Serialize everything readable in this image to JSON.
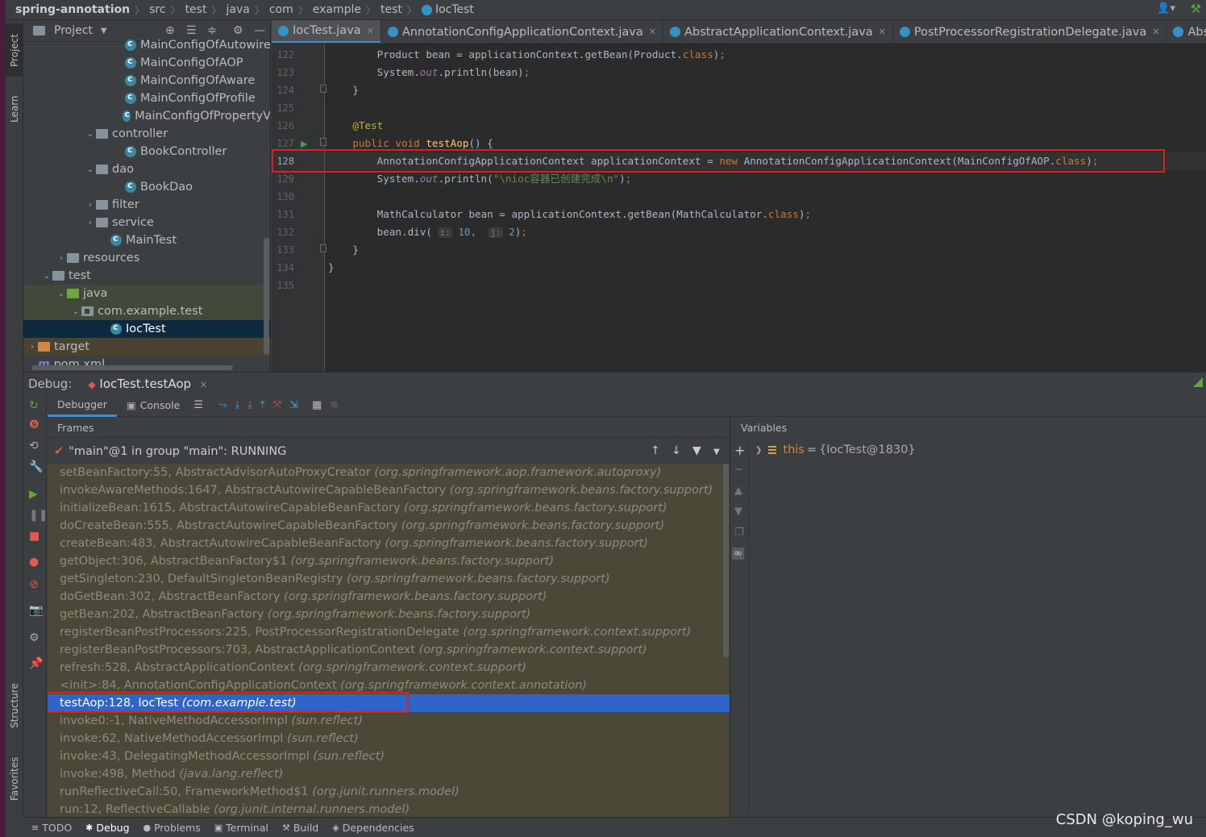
{
  "breadcrumb": [
    "spring-annotation",
    "src",
    "test",
    "java",
    "com",
    "example",
    "test",
    "IocTest"
  ],
  "left_stripe": {
    "project": "Project",
    "learn": "Learn",
    "structure": "Structure",
    "favorites": "Favorites"
  },
  "project_panel": {
    "title": "Project",
    "tree": [
      {
        "label": "MainConfigOfAutowire",
        "type": "class",
        "indent": 7
      },
      {
        "label": "MainConfigOfAOP",
        "type": "class",
        "indent": 7
      },
      {
        "label": "MainConfigOfAware",
        "type": "class",
        "indent": 7
      },
      {
        "label": "MainConfigOfProfile",
        "type": "class",
        "indent": 7
      },
      {
        "label": "MainConfigOfPropertyV",
        "type": "class",
        "indent": 7
      },
      {
        "label": "controller",
        "type": "folder",
        "indent": 5,
        "arrow": "down"
      },
      {
        "label": "BookController",
        "type": "class",
        "indent": 7
      },
      {
        "label": "dao",
        "type": "folder",
        "indent": 5,
        "arrow": "down"
      },
      {
        "label": "BookDao",
        "type": "class",
        "indent": 7
      },
      {
        "label": "filter",
        "type": "folder",
        "indent": 5,
        "arrow": "right"
      },
      {
        "label": "service",
        "type": "folder",
        "indent": 5,
        "arrow": "right"
      },
      {
        "label": "MainTest",
        "type": "class",
        "indent": 6
      },
      {
        "label": "resources",
        "type": "folder-res",
        "indent": 3,
        "arrow": "right"
      },
      {
        "label": "test",
        "type": "folder",
        "indent": 2,
        "arrow": "down"
      },
      {
        "label": "java",
        "type": "folder-green",
        "indent": 3,
        "arrow": "down",
        "style": "hl"
      },
      {
        "label": "com.example.test",
        "type": "folder-pkg",
        "indent": 4,
        "arrow": "down",
        "style": "hl"
      },
      {
        "label": "IocTest",
        "type": "class",
        "indent": 6,
        "style": "sel"
      },
      {
        "label": "target",
        "type": "folder-orange",
        "indent": 1,
        "arrow": "right",
        "style": "olive"
      },
      {
        "label": "pom.xml",
        "type": "maven",
        "indent": 1
      }
    ]
  },
  "editor_tabs": [
    {
      "label": "IocTest.java",
      "active": true
    },
    {
      "label": "AnnotationConfigApplicationContext.java",
      "active": false
    },
    {
      "label": "AbstractApplicationContext.java",
      "active": false
    },
    {
      "label": "PostProcessorRegistrationDelegate.java",
      "active": false
    },
    {
      "label": "Abstract",
      "active": false
    }
  ],
  "editor": {
    "lines": [
      {
        "n": "122",
        "html": "        Product bean = applicationContext.getBean(Product.<span class='kw'>class</span>)<span class='kw'>;</span>"
      },
      {
        "n": "123",
        "html": "        System.<span class='ital'>out</span>.println(bean)<span class='kw'>;</span>"
      },
      {
        "n": "124",
        "html": "    }"
      },
      {
        "n": "125",
        "html": ""
      },
      {
        "n": "126",
        "html": "    <span class='ann'>@Test</span>"
      },
      {
        "n": "127",
        "html": "    <span class='kw'>public void </span><span class='fn'>testAop</span>() {"
      },
      {
        "n": "128",
        "html": "        AnnotationConfigApplicationContext applicationContext = <span class='kw'>new </span>AnnotationConfigApplicationContext(MainConfigOfAOP.<span class='kw'>class</span>)<span class='kw'>;</span>"
      },
      {
        "n": "129",
        "html": "        System.<span class='ital'>out</span>.println(<span class='str'>\"\\nioc容器已创建完成\\n\"</span>)<span class='kw'>;</span>"
      },
      {
        "n": "130",
        "html": ""
      },
      {
        "n": "131",
        "html": "        MathCalculator bean = applicationContext.getBean(MathCalculator.<span class='kw'>class</span>)<span class='kw'>;</span>"
      },
      {
        "n": "132",
        "html": "        bean.div( <span class='hint'>i:</span> <span style='color:#6897bb'>10</span><span class='kw'>, </span> <span class='hint'>j:</span> <span style='color:#6897bb'>2</span>)<span class='kw'>;</span>"
      },
      {
        "n": "133",
        "html": "    }"
      },
      {
        "n": "134",
        "html": "}"
      },
      {
        "n": "135",
        "html": ""
      }
    ]
  },
  "debug": {
    "title": "Debug:",
    "session_tab": "IocTest.testAop",
    "tabs": {
      "debugger": "Debugger",
      "console": "Console"
    },
    "frames_label": "Frames",
    "variables_label": "Variables",
    "thread": "\"main\"@1 in group \"main\": RUNNING",
    "frames": [
      {
        "method": "setBeanFactory:55, AbstractAdvisorAutoProxyCreator",
        "pkg": "(org.springframework.aop.framework.autoproxy)"
      },
      {
        "method": "invokeAwareMethods:1647, AbstractAutowireCapableBeanFactory",
        "pkg": "(org.springframework.beans.factory.support)"
      },
      {
        "method": "initializeBean:1615, AbstractAutowireCapableBeanFactory",
        "pkg": "(org.springframework.beans.factory.support)"
      },
      {
        "method": "doCreateBean:555, AbstractAutowireCapableBeanFactory",
        "pkg": "(org.springframework.beans.factory.support)"
      },
      {
        "method": "createBean:483, AbstractAutowireCapableBeanFactory",
        "pkg": "(org.springframework.beans.factory.support)"
      },
      {
        "method": "getObject:306, AbstractBeanFactory$1",
        "pkg": "(org.springframework.beans.factory.support)"
      },
      {
        "method": "getSingleton:230, DefaultSingletonBeanRegistry",
        "pkg": "(org.springframework.beans.factory.support)"
      },
      {
        "method": "doGetBean:302, AbstractBeanFactory",
        "pkg": "(org.springframework.beans.factory.support)"
      },
      {
        "method": "getBean:202, AbstractBeanFactory",
        "pkg": "(org.springframework.beans.factory.support)"
      },
      {
        "method": "registerBeanPostProcessors:225, PostProcessorRegistrationDelegate",
        "pkg": "(org.springframework.context.support)"
      },
      {
        "method": "registerBeanPostProcessors:703, AbstractApplicationContext",
        "pkg": "(org.springframework.context.support)"
      },
      {
        "method": "refresh:528, AbstractApplicationContext",
        "pkg": "(org.springframework.context.support)"
      },
      {
        "method": "<init>:84, AnnotationConfigApplicationContext",
        "pkg": "(org.springframework.context.annotation)"
      },
      {
        "method": "testAop:128, IocTest",
        "pkg": "(com.example.test)",
        "selected": true
      },
      {
        "method": "invoke0:-1, NativeMethodAccessorImpl",
        "pkg": "(sun.reflect)"
      },
      {
        "method": "invoke:62, NativeMethodAccessorImpl",
        "pkg": "(sun.reflect)"
      },
      {
        "method": "invoke:43, DelegatingMethodAccessorImpl",
        "pkg": "(sun.reflect)"
      },
      {
        "method": "invoke:498, Method",
        "pkg": "(java.lang.reflect)"
      },
      {
        "method": "runReflectiveCall:50, FrameworkMethod$1",
        "pkg": "(org.junit.runners.model)"
      },
      {
        "method": "run:12, ReflectiveCallable",
        "pkg": "(org.junit.internal.runners.model)"
      }
    ],
    "variable": {
      "name": "this",
      "eq": "=",
      "value": "{IocTest@1830}"
    }
  },
  "statusbar": [
    {
      "label": "TODO",
      "icon": "≡"
    },
    {
      "label": "Debug",
      "icon": "✱",
      "active": true
    },
    {
      "label": "Problems",
      "icon": "●"
    },
    {
      "label": "Terminal",
      "icon": "▣"
    },
    {
      "label": "Build",
      "icon": "⚒"
    },
    {
      "label": "Dependencies",
      "icon": "◈"
    }
  ],
  "watermark": "CSDN @koping_wu",
  "colors": {
    "accent": "#4a88c7",
    "selection": "#2f65ca",
    "highlight_box": "#e0201e"
  }
}
